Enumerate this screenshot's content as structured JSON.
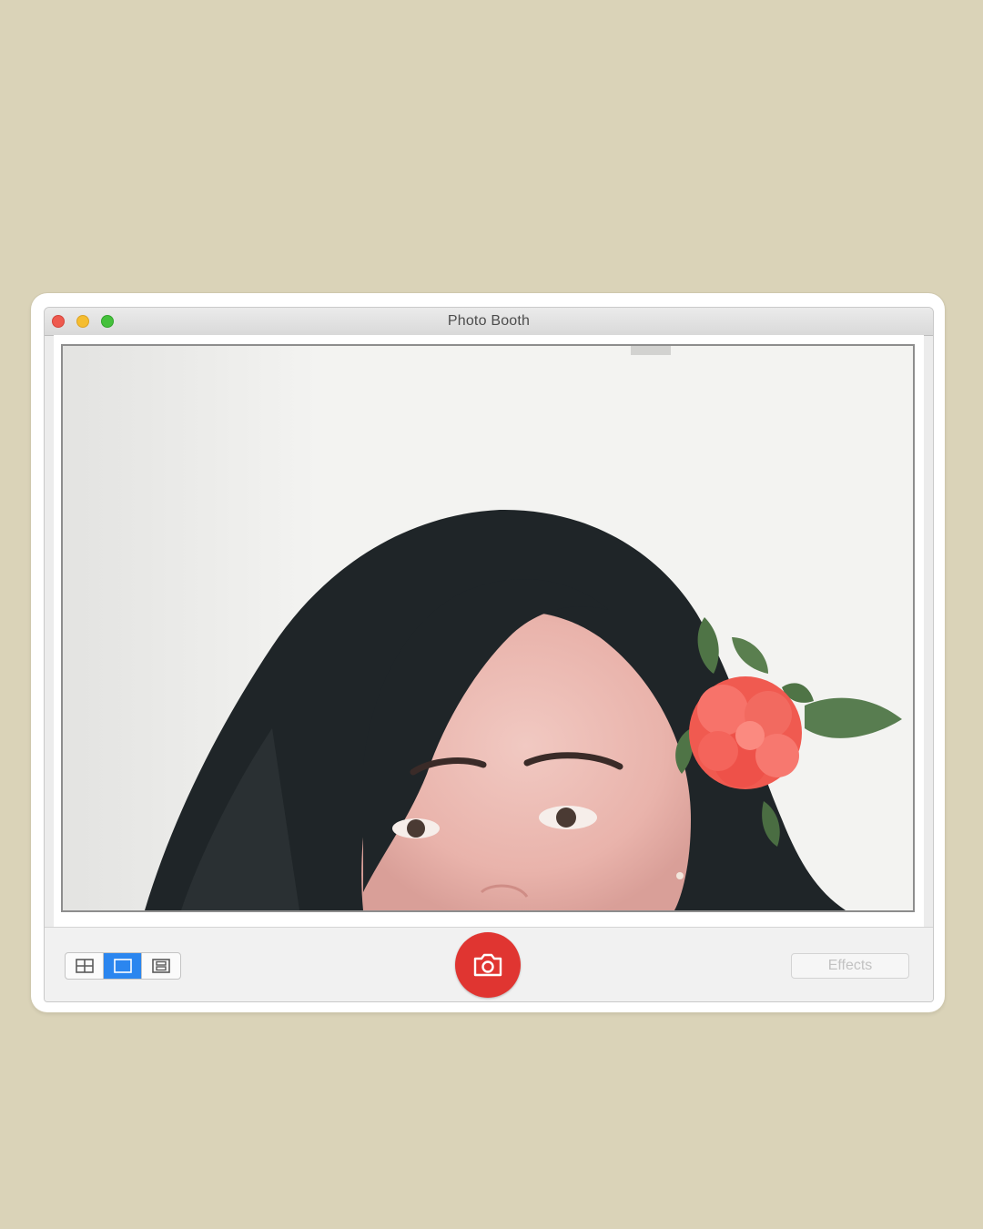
{
  "window": {
    "title": "Photo Booth"
  },
  "toolbar": {
    "view_modes": [
      {
        "name": "grid",
        "icon": "four-up-grid-icon",
        "active": false
      },
      {
        "name": "single",
        "icon": "single-photo-icon",
        "active": true
      },
      {
        "name": "filmstrip",
        "icon": "filmstrip-icon",
        "active": false
      }
    ],
    "shutter_icon": "camera-icon",
    "effects_label": "Effects"
  },
  "colors": {
    "background": "#dad3b8",
    "shutter": "#e03531",
    "active_segment": "#2b86ef",
    "flower": "#f4584f"
  }
}
